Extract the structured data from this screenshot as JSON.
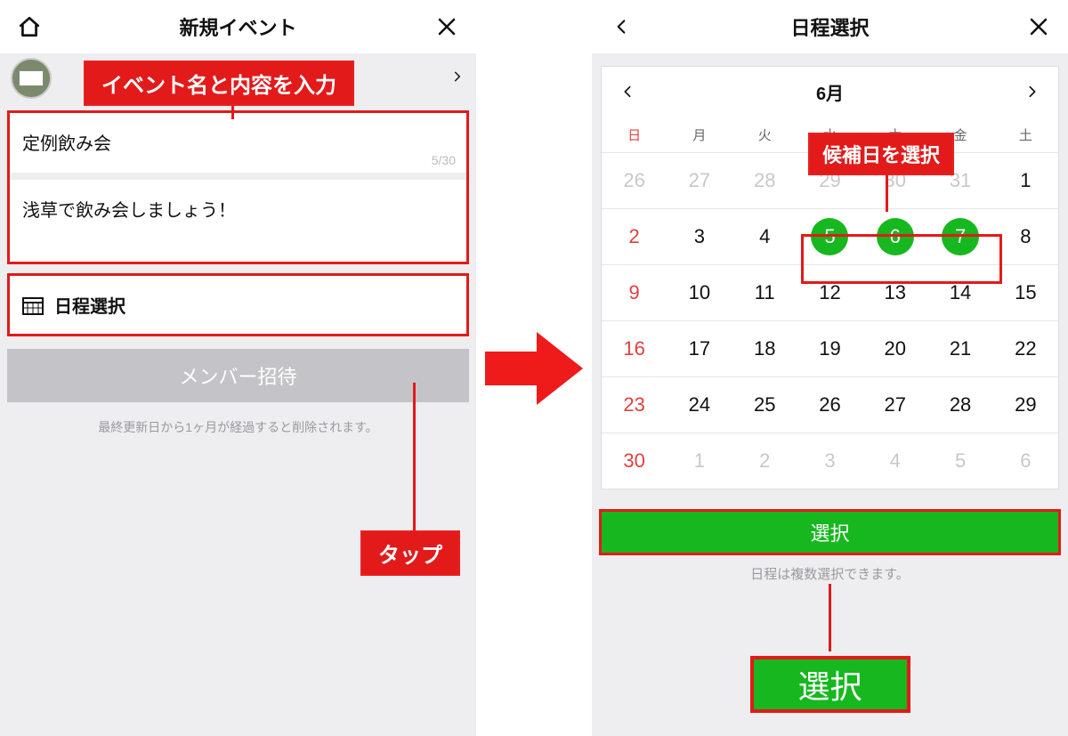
{
  "left": {
    "header_title": "新規イベント",
    "callout_top": "イベント名と内容を入力",
    "event_name": "定例飲み会",
    "counter": "5/30",
    "event_desc": "浅草で飲み会しましょう！",
    "schedule_label": "日程選択",
    "invite_label": "メンバー招待",
    "footnote": "最終更新日から1ヶ月が経過すると削除されます。",
    "callout_tap": "タップ"
  },
  "right": {
    "header_title": "日程選択",
    "month": "6月",
    "dow": [
      "日",
      "月",
      "火",
      "水",
      "木",
      "金",
      "土"
    ],
    "callout_candidate": "候補日を選択",
    "weeks": [
      [
        {
          "n": "26",
          "o": true
        },
        {
          "n": "27",
          "o": true
        },
        {
          "n": "28",
          "o": true
        },
        {
          "n": "29",
          "o": true
        },
        {
          "n": "30",
          "o": true
        },
        {
          "n": "31",
          "o": true
        },
        {
          "n": "1"
        }
      ],
      [
        {
          "n": "2",
          "sun": true
        },
        {
          "n": "3"
        },
        {
          "n": "4"
        },
        {
          "n": "5",
          "sel": true
        },
        {
          "n": "6",
          "sel": true
        },
        {
          "n": "7",
          "sel": true
        },
        {
          "n": "8"
        }
      ],
      [
        {
          "n": "9",
          "sun": true
        },
        {
          "n": "10"
        },
        {
          "n": "11"
        },
        {
          "n": "12"
        },
        {
          "n": "13"
        },
        {
          "n": "14"
        },
        {
          "n": "15"
        }
      ],
      [
        {
          "n": "16",
          "sun": true
        },
        {
          "n": "17"
        },
        {
          "n": "18"
        },
        {
          "n": "19"
        },
        {
          "n": "20"
        },
        {
          "n": "21"
        },
        {
          "n": "22"
        }
      ],
      [
        {
          "n": "23",
          "sun": true
        },
        {
          "n": "24"
        },
        {
          "n": "25"
        },
        {
          "n": "26"
        },
        {
          "n": "27"
        },
        {
          "n": "28"
        },
        {
          "n": "29"
        }
      ],
      [
        {
          "n": "30",
          "sun": true
        },
        {
          "n": "1",
          "o": true
        },
        {
          "n": "2",
          "o": true
        },
        {
          "n": "3",
          "o": true
        },
        {
          "n": "4",
          "o": true
        },
        {
          "n": "5",
          "o": true
        },
        {
          "n": "6",
          "o": true
        }
      ]
    ],
    "select_button": "選択",
    "select_note": "日程は複数選択できます。",
    "select_big": "選択"
  }
}
